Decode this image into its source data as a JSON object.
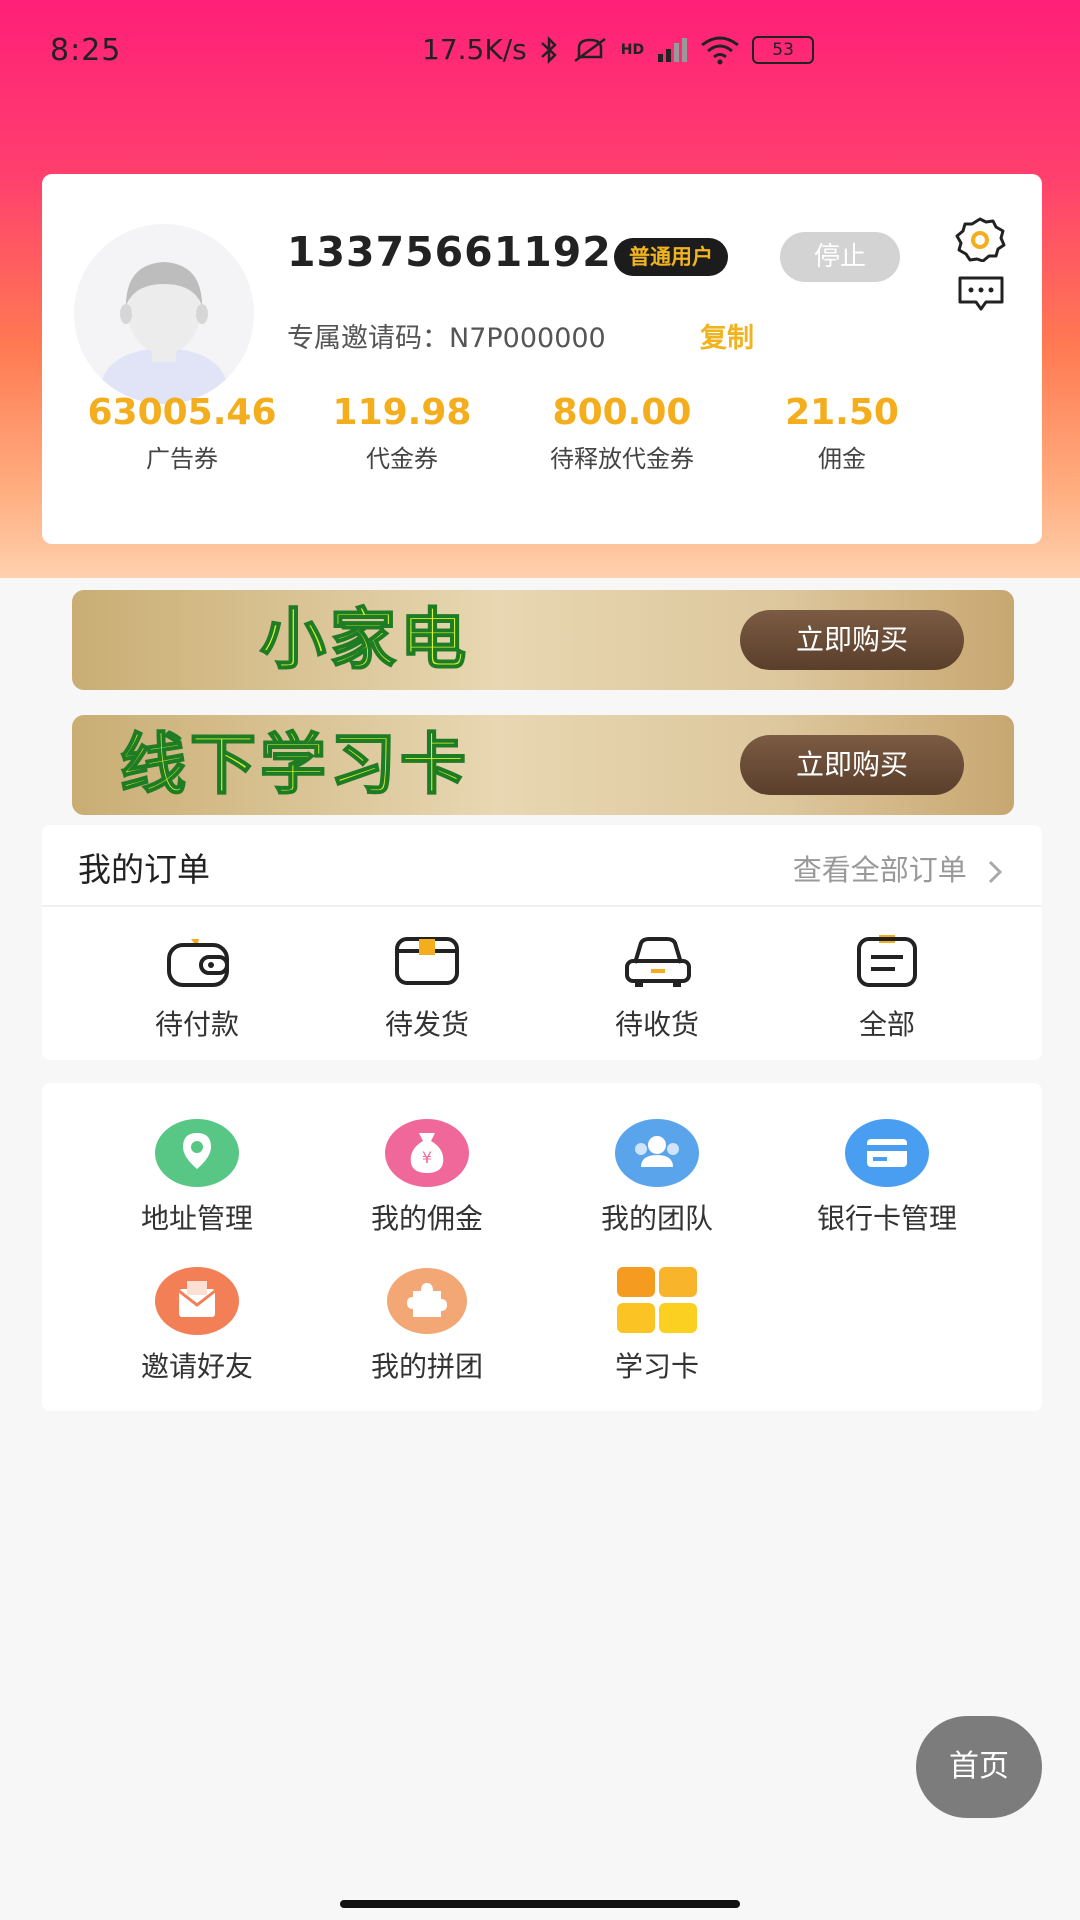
{
  "status_bar": {
    "time": "8:25",
    "network_speed": "17.5K/s",
    "network_type": "HD",
    "battery": "53",
    "icons": [
      "bluetooth-icon",
      "mute-icon",
      "signal-icon",
      "wifi-icon",
      "battery-icon"
    ]
  },
  "profile": {
    "phone": "13375661192",
    "user_level": "普通用户",
    "stop_label": "停止",
    "invite_label": "专属邀请码：",
    "invite_code": "N7P000000",
    "copy_label": "复制",
    "stats": [
      {
        "value": "63005.46",
        "label": "广告券"
      },
      {
        "value": "119.98",
        "label": "代金券"
      },
      {
        "value": "800.00",
        "label": "待释放代金券"
      },
      {
        "value": "21.50",
        "label": "佣金"
      }
    ]
  },
  "banners": [
    {
      "title": "小家电",
      "button": "立即购买"
    },
    {
      "title": "线下学习卡",
      "button": "立即购买"
    }
  ],
  "orders": {
    "title": "我的订单",
    "view_all": "查看全部订单",
    "items": [
      {
        "label": "待付款",
        "icon": "wallet-icon"
      },
      {
        "label": "待发货",
        "icon": "box-icon"
      },
      {
        "label": "待收货",
        "icon": "truck-icon"
      },
      {
        "label": "全部",
        "icon": "list-icon"
      }
    ]
  },
  "services": [
    {
      "label": "地址管理",
      "icon": "location-icon"
    },
    {
      "label": "我的佣金",
      "icon": "money-bag-icon"
    },
    {
      "label": "我的团队",
      "icon": "team-icon"
    },
    {
      "label": "银行卡管理",
      "icon": "bank-card-icon"
    },
    {
      "label": "邀请好友",
      "icon": "invite-icon"
    },
    {
      "label": "我的拼团",
      "icon": "puzzle-icon"
    },
    {
      "label": "学习卡",
      "icon": "grid-icon"
    }
  ],
  "home_button": "首页",
  "colors": {
    "accent_gold": "#f4ad1c",
    "header_gradient_top": "#ff1f78",
    "header_gradient_bottom": "#ffd0ae"
  }
}
